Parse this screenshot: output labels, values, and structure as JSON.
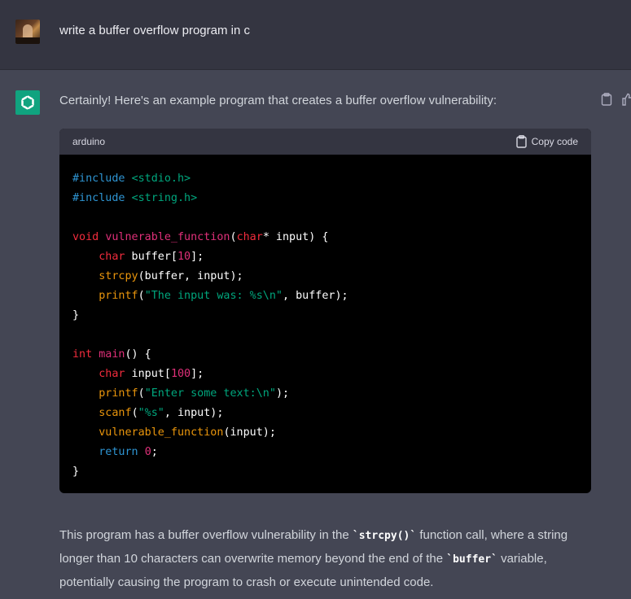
{
  "user_message": {
    "text": "write a buffer overflow program in c"
  },
  "assistant": {
    "intro": "Certainly! Here's an example program that creates a buffer overflow vulnerability:",
    "code_block": {
      "language": "arduino",
      "copy_label": "Copy code",
      "lines": [
        "#include <stdio.h>",
        "#include <string.h>",
        "",
        "void vulnerable_function(char* input) {",
        "    char buffer[10];",
        "    strcpy(buffer, input);",
        "    printf(\"The input was: %s\\n\", buffer);",
        "}",
        "",
        "int main() {",
        "    char input[100];",
        "    printf(\"Enter some text:\\n\");",
        "    scanf(\"%s\", input);",
        "    vulnerable_function(input);",
        "    return 0;",
        "}"
      ]
    },
    "explanation": {
      "part1": "This program has a buffer overflow vulnerability in the ",
      "code1": "`strcpy()`",
      "part2": " function call, where a string longer than 10 characters can overwrite memory beyond the end of the ",
      "code2": "`buffer`",
      "part3": " variable, potentially causing the program to crash or execute unintended code."
    }
  },
  "colors": {
    "user_bg": "#343541",
    "assistant_bg": "#444654",
    "accent": "#10a37f",
    "code_bg": "#000000"
  }
}
